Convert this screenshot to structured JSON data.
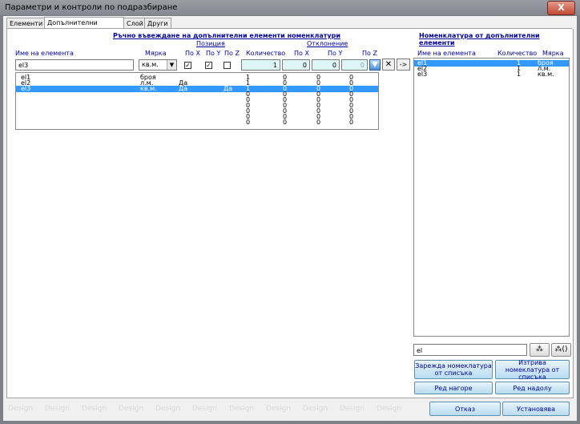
{
  "window": {
    "title": "Параметри и контроли по подразбиране",
    "close_glyph": "X"
  },
  "tabs": [
    "Елементи",
    "Допълнителни елементи",
    "Слой",
    "Други"
  ],
  "manual": {
    "title": "Ръчно въвеждане на допълнителни елементи номенклатури",
    "position_group": "Позиция",
    "deviation_group": "Отклонение",
    "headers": {
      "name": "Име на елемента",
      "unit": "Мярка",
      "pos_x": "По X",
      "pos_y": "По Y",
      "pos_z": "По Z",
      "quantity": "Количество",
      "dev_x": "По X",
      "dev_y": "По Y",
      "dev_z": "По Z"
    },
    "inputs": {
      "name": "el3",
      "unit": "кв.м.",
      "pos_x_checked": true,
      "pos_y_checked": true,
      "pos_z_checked": false,
      "quantity": "1",
      "dev_x": "0",
      "dev_y": "0",
      "dev_z": "0"
    },
    "rows": [
      {
        "name": "el1",
        "unit": "броя",
        "flag1": "",
        "flag2": "",
        "qty": "1",
        "x": "0",
        "y": "0",
        "z": "0",
        "selected": false
      },
      {
        "name": "el2",
        "unit": "л.м.",
        "flag1": "Да",
        "flag2": "",
        "qty": "1",
        "x": "0",
        "y": "0",
        "z": "0",
        "selected": false
      },
      {
        "name": "el3",
        "unit": "кв.м.",
        "flag1": "Да",
        "flag2": "Да",
        "qty": "1",
        "x": "0",
        "y": "0",
        "z": "0",
        "selected": true
      },
      {
        "name": "",
        "unit": "",
        "flag1": "",
        "flag2": "",
        "qty": "0",
        "x": "0",
        "y": "0",
        "z": "0",
        "selected": false
      },
      {
        "name": "",
        "unit": "",
        "flag1": "",
        "flag2": "",
        "qty": "0",
        "x": "0",
        "y": "0",
        "z": "0",
        "selected": false
      },
      {
        "name": "",
        "unit": "",
        "flag1": "",
        "flag2": "",
        "qty": "0",
        "x": "0",
        "y": "0",
        "z": "0",
        "selected": false
      },
      {
        "name": "",
        "unit": "",
        "flag1": "",
        "flag2": "",
        "qty": "0",
        "x": "0",
        "y": "0",
        "z": "0",
        "selected": false
      },
      {
        "name": "",
        "unit": "",
        "flag1": "",
        "flag2": "",
        "qty": "0",
        "x": "0",
        "y": "0",
        "z": "0",
        "selected": false
      },
      {
        "name": "",
        "unit": "",
        "flag1": "",
        "flag2": "",
        "qty": "0",
        "x": "0",
        "y": "0",
        "z": "0",
        "selected": false
      }
    ],
    "clear_glyph": "✕",
    "transfer_label": "->"
  },
  "nomenclature": {
    "title": "Номенклатура от допълнителни елементи",
    "headers": {
      "name": "Име на елемента",
      "quantity": "Количество",
      "unit": "Мярка"
    },
    "rows": [
      {
        "name": "el1",
        "qty": "1",
        "unit": "броя",
        "selected": true
      },
      {
        "name": "el2",
        "qty": "1",
        "unit": "л.м.",
        "selected": false
      },
      {
        "name": "el3",
        "qty": "1",
        "unit": "кв.м.",
        "selected": false
      }
    ],
    "search_value": "el",
    "btn_load": "Зарежда номеклатура от списъка",
    "btn_delete": "Изтрива номеклатура от списъка",
    "btn_up": "Ред нагоре",
    "btn_down": "Ред надолу"
  },
  "footer": {
    "watermark": "Design",
    "cancel": "Отказ",
    "ok": "Установява"
  },
  "colors": {
    "accent": "#0000a0",
    "selection": "#3399ff",
    "button": "#b8dcf0"
  }
}
